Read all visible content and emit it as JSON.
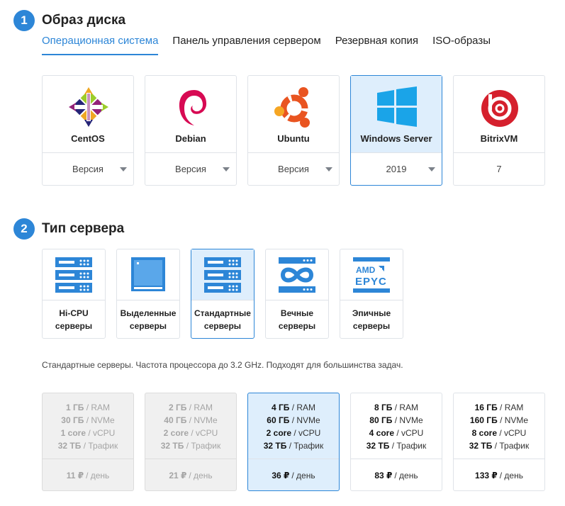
{
  "section1": {
    "number": "1",
    "title": "Образ диска",
    "tabs": [
      {
        "label": "Операционная система",
        "active": true
      },
      {
        "label": "Панель управления сервером",
        "active": false
      },
      {
        "label": "Резервная копия",
        "active": false
      },
      {
        "label": "ISO-образы",
        "active": false
      }
    ],
    "os": [
      {
        "name": "CentOS",
        "version": "Версия",
        "icon": "centos-logo-icon",
        "dropdown": true,
        "selected": false
      },
      {
        "name": "Debian",
        "version": "Версия",
        "icon": "debian-logo-icon",
        "dropdown": true,
        "selected": false
      },
      {
        "name": "Ubuntu",
        "version": "Версия",
        "icon": "ubuntu-logo-icon",
        "dropdown": true,
        "selected": false
      },
      {
        "name": "Windows Server",
        "version": "2019",
        "icon": "windows-logo-icon",
        "dropdown": true,
        "selected": true
      },
      {
        "name": "BitrixVM",
        "version": "7",
        "icon": "bitrix-logo-icon",
        "dropdown": false,
        "selected": false
      }
    ]
  },
  "section2": {
    "number": "2",
    "title": "Тип сервера",
    "types": [
      {
        "line1": "Hi-CPU",
        "line2": "серверы",
        "icon": "server-rack-icon",
        "selected": false
      },
      {
        "line1": "Выделенные",
        "line2": "серверы",
        "icon": "dedicated-server-icon",
        "selected": false
      },
      {
        "line1": "Стандартные",
        "line2": "серверы",
        "icon": "server-rack-icon",
        "selected": true
      },
      {
        "line1": "Вечные",
        "line2": "серверы",
        "icon": "infinity-icon",
        "selected": false
      },
      {
        "line1": "Эпичные",
        "line2": "серверы",
        "icon": "amd-epyc-icon",
        "selected": false
      }
    ],
    "description": "Стандартные серверы. Частота процессора до 3.2 GHz. Подходят для большинства задач.",
    "plans": [
      {
        "ram": "1 ГБ",
        "disk": "30 ГБ",
        "cpu": "1 core",
        "traffic": "32 ТБ",
        "price": "11 ₽",
        "state": "disabled"
      },
      {
        "ram": "2 ГБ",
        "disk": "40 ГБ",
        "cpu": "2 core",
        "traffic": "32 ТБ",
        "price": "21 ₽",
        "state": "disabled"
      },
      {
        "ram": "4 ГБ",
        "disk": "60 ГБ",
        "cpu": "2 core",
        "traffic": "32 ТБ",
        "price": "36 ₽",
        "state": "selected"
      },
      {
        "ram": "8 ГБ",
        "disk": "80 ГБ",
        "cpu": "4 core",
        "traffic": "32 ТБ",
        "price": "83 ₽",
        "state": "normal"
      },
      {
        "ram": "16 ГБ",
        "disk": "160 ГБ",
        "cpu": "8 core",
        "traffic": "32 ТБ",
        "price": "133 ₽",
        "state": "normal"
      }
    ],
    "spec_units": {
      "ram": "/ RAM",
      "disk": "/ NVMe",
      "cpu": "/ vCPU",
      "traffic": "/ Трафик",
      "price": "/ день"
    }
  },
  "colors": {
    "accent": "#2d86d7",
    "selected_bg": "#deeefc",
    "disabled_bg": "#f0f0f0"
  }
}
